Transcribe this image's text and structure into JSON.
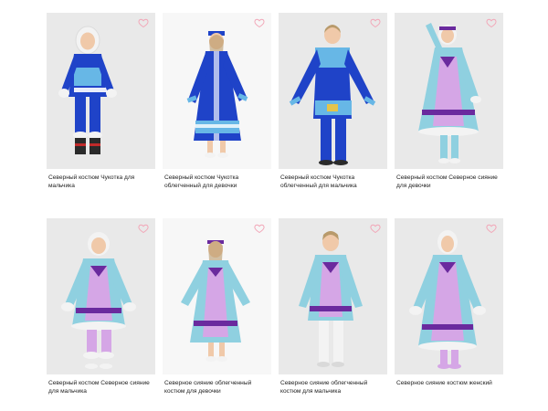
{
  "colors": {
    "favorite_outline": "#f2a7b8",
    "royal_blue": "#1f43c8",
    "sky_blue": "#67b7e6",
    "light_turquoise": "#8fd0e0",
    "lilac": "#d5a6e6",
    "purple": "#6a2a9e",
    "white_fur": "#f3f3f3",
    "background_grey": "#e9e9e9",
    "background_white": "#f7f7f7"
  },
  "products": [
    {
      "title": "Северный костюм Чукотка для мальчика",
      "favorite_icon": "heart-outline"
    },
    {
      "title": "Северный костюм Чукотка облегченный для девочки",
      "favorite_icon": "heart-outline"
    },
    {
      "title": "Северный костюм Чукотка облегченный для мальчика",
      "favorite_icon": "heart-outline"
    },
    {
      "title": "Северный костюм Северное сияние для девочки",
      "favorite_icon": "heart-outline"
    },
    {
      "title": "Северный костюм Северное сияние для мальчика",
      "favorite_icon": "heart-outline"
    },
    {
      "title": "Северное сияние облегченный костюм для девочки",
      "favorite_icon": "heart-outline"
    },
    {
      "title": "Северное сияние облегченный костюм для мальчика",
      "favorite_icon": "heart-outline"
    },
    {
      "title": "Северное сияние костюм женский",
      "favorite_icon": "heart-outline"
    }
  ]
}
